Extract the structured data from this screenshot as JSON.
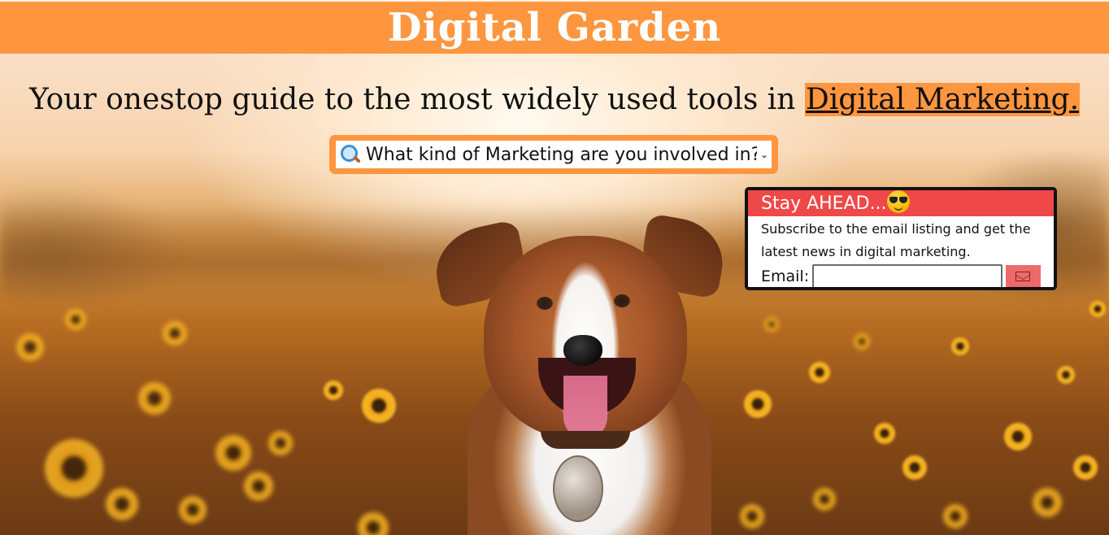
{
  "header": {
    "title": "Digital Garden"
  },
  "tagline": {
    "text": "Your onestop guide to the most widely used tools in ",
    "link_text": "Digital Marketing."
  },
  "search_select": {
    "icon": "magnifying-glass-icon",
    "selected_text": "What kind of Marketing are you involved in?..."
  },
  "subscribe": {
    "title": "Stay AHEAD...",
    "title_icon": "sunglasses-emoji-icon",
    "description": "Subscribe to the email listing and get the latest news in digital marketing.",
    "email_label": "Email:",
    "email_value": "",
    "email_placeholder": "",
    "send_icon": "envelope-icon"
  },
  "colors": {
    "accent": "#fe9640",
    "card_header": "#ef4848",
    "send_button": "#ee6a6a"
  }
}
